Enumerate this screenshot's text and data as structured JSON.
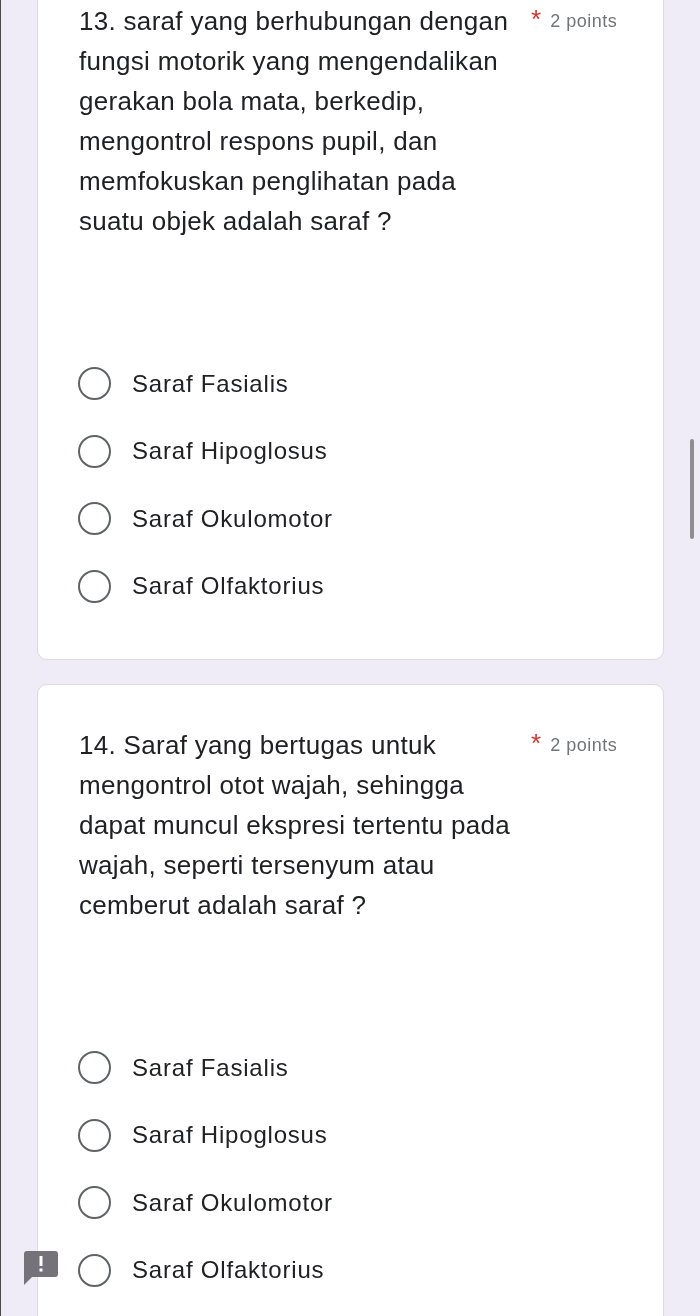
{
  "questions": [
    {
      "title": "13. saraf yang berhubungan dengan fungsi motorik yang mengendalikan gerakan bola mata, berkedip, mengontrol respons pupil, dan memfokuskan penglihatan pada suatu objek adalah saraf ?",
      "required_mark": "*",
      "points": "2 points",
      "options": [
        {
          "label": "Saraf Fasialis",
          "selected": false
        },
        {
          "label": "Saraf Hipoglosus",
          "selected": false
        },
        {
          "label": "Saraf Okulomotor",
          "selected": false
        },
        {
          "label": "Saraf Olfaktorius",
          "selected": false
        }
      ]
    },
    {
      "title": "14. Saraf yang bertugas untuk mengontrol otot wajah, sehingga dapat muncul ekspresi tertentu pada wajah, seperti tersenyum atau cemberut adalah saraf ?",
      "required_mark": "*",
      "points": "2 points",
      "options": [
        {
          "label": "Saraf Fasialis",
          "selected": false
        },
        {
          "label": "Saraf Hipoglosus",
          "selected": false
        },
        {
          "label": "Saraf Okulomotor",
          "selected": false
        },
        {
          "label": "Saraf Olfaktorius",
          "selected": false
        }
      ]
    }
  ]
}
